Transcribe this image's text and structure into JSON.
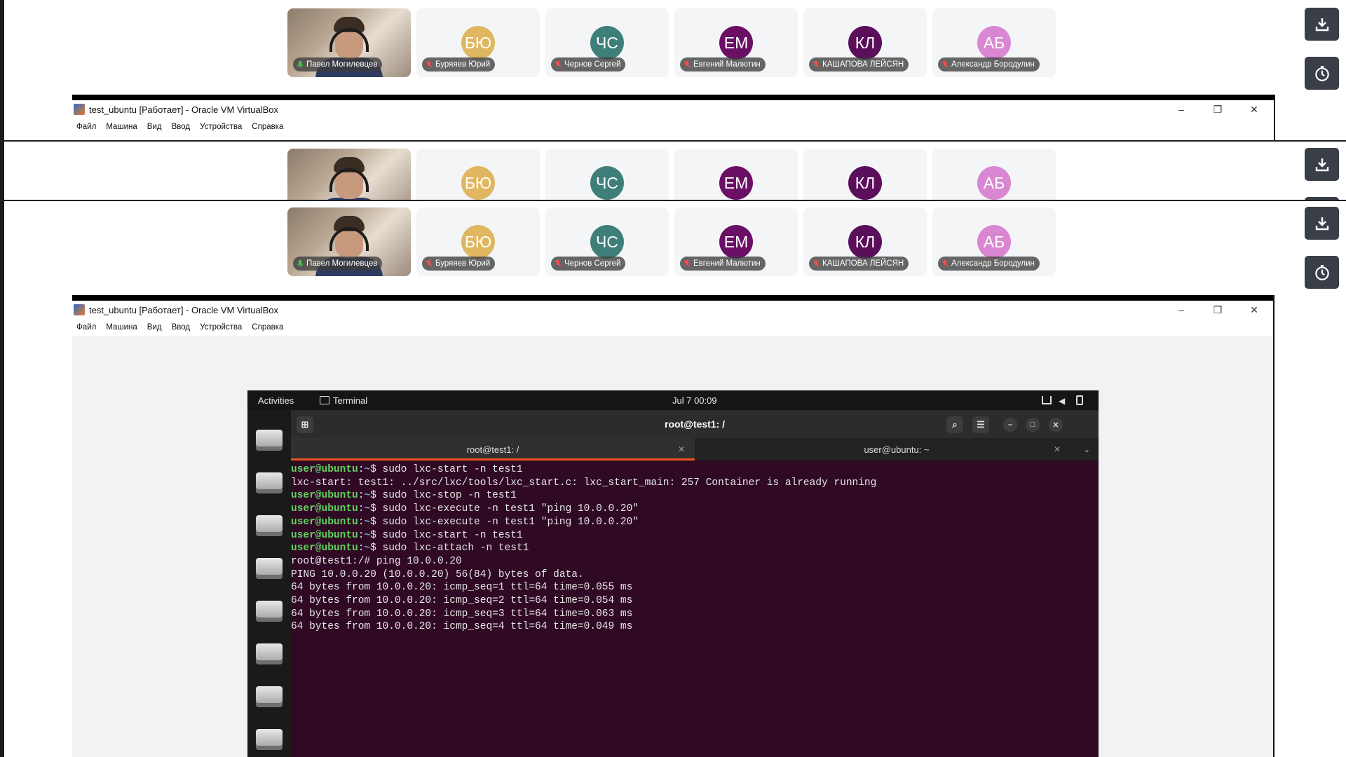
{
  "participants": [
    {
      "name": "Павел Могилевцев",
      "initials": "",
      "video": true,
      "color": "",
      "mic": "on"
    },
    {
      "name": "Буряяев Юрий",
      "initials": "БЮ",
      "video": false,
      "color": "#e0b760",
      "mic": "off"
    },
    {
      "name": "Чернов Сергей",
      "initials": "ЧС",
      "video": false,
      "color": "#3f7f7a",
      "mic": "off"
    },
    {
      "name": "Евгений Малютин",
      "initials": "ЕМ",
      "video": false,
      "color": "#6b0f66",
      "mic": "off"
    },
    {
      "name": "КАШАПОВА ЛЕЙСЯН",
      "initials": "КЛ",
      "video": false,
      "color": "#5b0e5a",
      "mic": "off"
    },
    {
      "name": "Александр Бородулин",
      "initials": "АБ",
      "video": false,
      "color": "#d987d3",
      "mic": "off"
    }
  ],
  "side_buttons": {
    "download_icon": "download-icon",
    "timer_icon": "timer-icon"
  },
  "vbox": {
    "title": "test_ubuntu [Работает] - Oracle VM VirtualBox",
    "menu": [
      "Файл",
      "Машина",
      "Вид",
      "Ввод",
      "Устройства",
      "Справка"
    ],
    "minimize": "–",
    "restore": "❐",
    "close": "✕"
  },
  "ubuntu": {
    "activities": "Activities",
    "app": "Terminal",
    "clock": "Jul 7  00:09",
    "window_title": "root@test1: /",
    "tabs": [
      {
        "label": "root@test1: /",
        "active": true
      },
      {
        "label": "user@ubuntu: ~",
        "active": false
      }
    ],
    "terminal_lines": [
      {
        "user": "user@ubuntu",
        "path": "~",
        "cmd": "sudo lxc-start -n test1"
      },
      {
        "text": "lxc-start: test1: ../src/lxc/tools/lxc_start.c: lxc_start_main: 257 Container is already running"
      },
      {
        "user": "user@ubuntu",
        "path": "~",
        "cmd": "sudo lxc-stop -n test1"
      },
      {
        "user": "user@ubuntu",
        "path": "~",
        "cmd": "sudo lxc-execute -n test1 \"ping 10.0.0.20\""
      },
      {
        "user": "user@ubuntu",
        "path": "~",
        "cmd": "sudo lxc-execute -n test1 \"ping 10.0.0.20\""
      },
      {
        "user": "user@ubuntu",
        "path": "~",
        "cmd": "sudo lxc-start -n test1"
      },
      {
        "user": "user@ubuntu",
        "path": "~",
        "cmd": "sudo lxc-attach -n test1"
      },
      {
        "text": "root@test1:/# ping 10.0.0.20"
      },
      {
        "text": "PING 10.0.0.20 (10.0.0.20) 56(84) bytes of data."
      },
      {
        "text": "64 bytes from 10.0.0.20: icmp_seq=1 ttl=64 time=0.055 ms"
      },
      {
        "text": "64 bytes from 10.0.0.20: icmp_seq=2 ttl=64 time=0.054 ms"
      },
      {
        "text": "64 bytes from 10.0.0.20: icmp_seq=3 ttl=64 time=0.063 ms"
      },
      {
        "text": "64 bytes from 10.0.0.20: icmp_seq=4 ttl=64 time=0.049 ms"
      }
    ]
  }
}
